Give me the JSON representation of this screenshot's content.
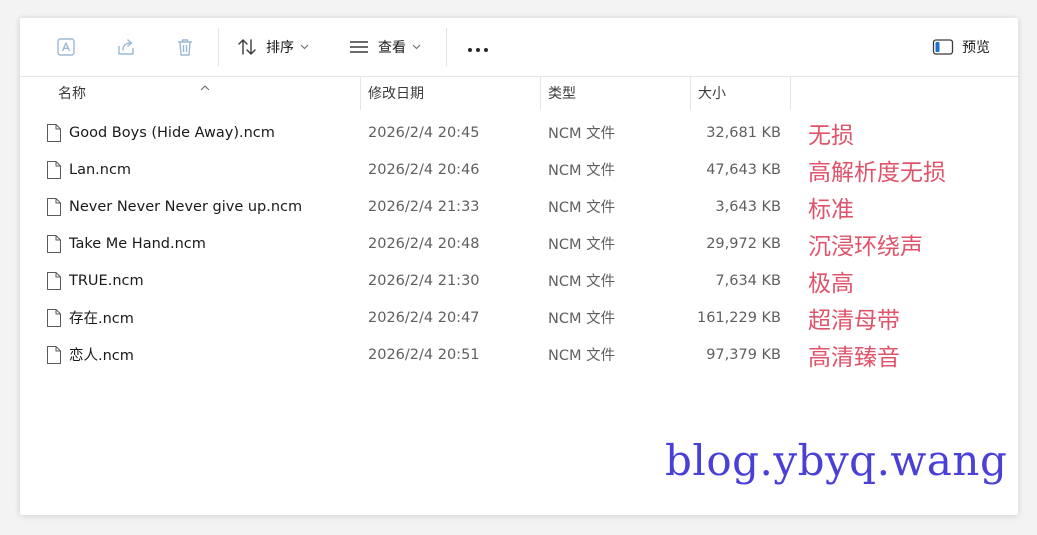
{
  "toolbar": {
    "sort_label": "排序",
    "view_label": "查看",
    "more_label": "···",
    "preview_label": "预览"
  },
  "columns": {
    "name": "名称",
    "modified": "修改日期",
    "type": "类型",
    "size": "大小"
  },
  "files": [
    {
      "name": "Good Boys (Hide Away).ncm",
      "modified": "2026/2/4 20:45",
      "type": "NCM 文件",
      "size": "32,681 KB",
      "note": "无损"
    },
    {
      "name": "Lan.ncm",
      "modified": "2026/2/4 20:46",
      "type": "NCM 文件",
      "size": "47,643 KB",
      "note": "高解析度无损"
    },
    {
      "name": "Never Never Never give up.ncm",
      "modified": "2026/2/4 21:33",
      "type": "NCM 文件",
      "size": "3,643 KB",
      "note": "标准"
    },
    {
      "name": "Take Me Hand.ncm",
      "modified": "2026/2/4 20:48",
      "type": "NCM 文件",
      "size": "29,972 KB",
      "note": "沉浸环绕声"
    },
    {
      "name": "TRUE.ncm",
      "modified": "2026/2/4 21:30",
      "type": "NCM 文件",
      "size": "7,634 KB",
      "note": "极高"
    },
    {
      "name": "存在.ncm",
      "modified": "2026/2/4 20:47",
      "type": "NCM 文件",
      "size": "161,229 KB",
      "note": "超清母带"
    },
    {
      "name": "恋人.ncm",
      "modified": "2026/2/4 20:51",
      "type": "NCM 文件",
      "size": "97,379 KB",
      "note": "高清臻音"
    }
  ],
  "watermark": "blog.ybyq.wang",
  "colors": {
    "note": "#e0546b",
    "watermark": "#4a3fd6",
    "icon_disabled": "#9bb8d3",
    "preview_accent": "#1a73c8"
  }
}
